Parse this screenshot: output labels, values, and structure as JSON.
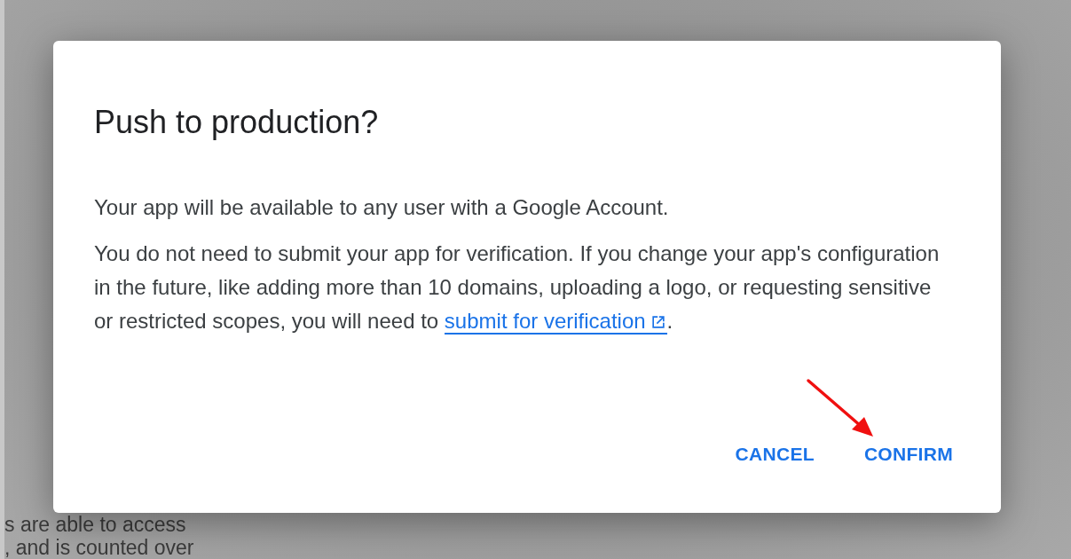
{
  "background_text": [
    "s are able to access",
    ", and is counted over"
  ],
  "dialog": {
    "title": "Push to production?",
    "paragraphs": [
      {
        "text": "Your app will be available to any user with a Google Account."
      },
      {
        "text": "You do not need to submit your app for verification. If you change your app's configuration in the future, like adding more than 10 domains, uploading a logo, or requesting sensitive or restricted scopes, you will need to",
        "link": "submit for verification",
        "after": "."
      }
    ],
    "buttons": [
      "CANCEL",
      "CONFIRM"
    ]
  }
}
